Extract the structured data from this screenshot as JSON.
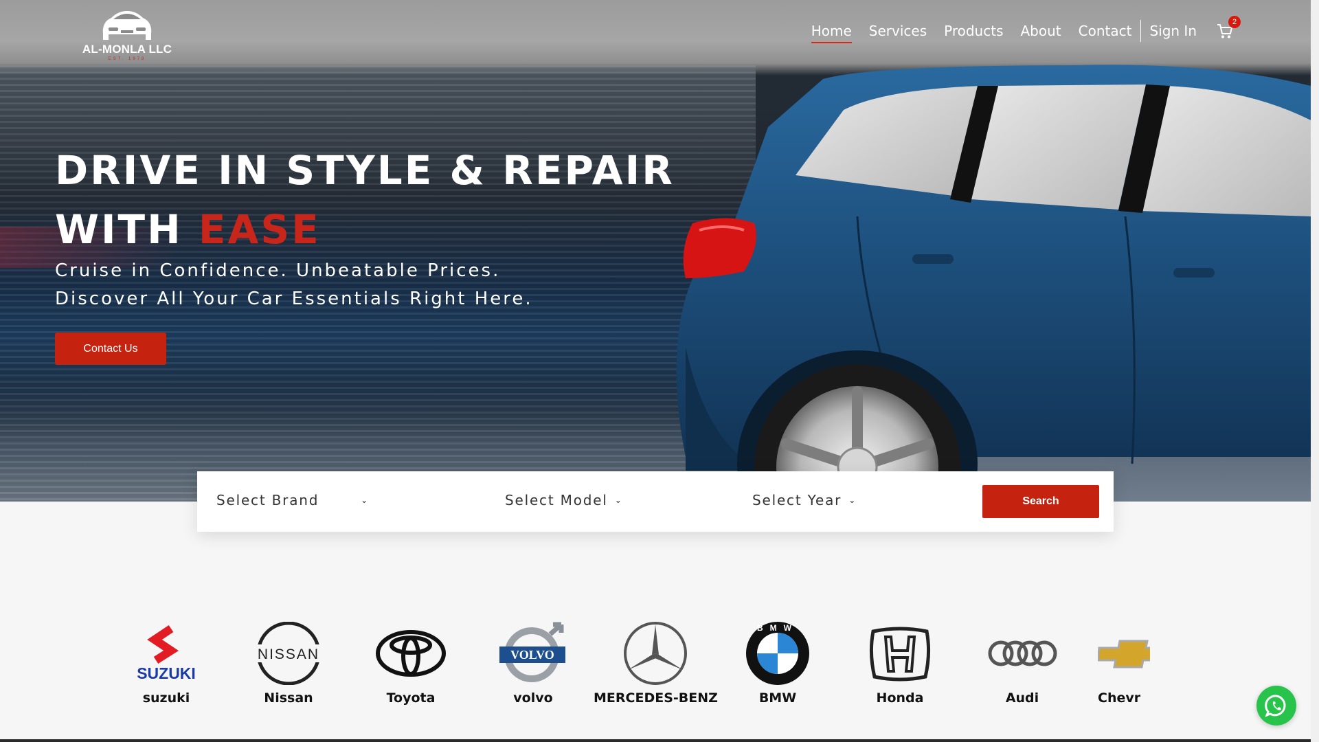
{
  "brand": {
    "name": "AL-MONLA LLC",
    "tagline": "EST. 1978"
  },
  "nav": {
    "items": [
      {
        "label": "Home",
        "active": true
      },
      {
        "label": "Services"
      },
      {
        "label": "Products"
      },
      {
        "label": "About"
      },
      {
        "label": "Contact"
      }
    ],
    "signin": "Sign In",
    "cart_count": "2",
    "cart_icon": "cart-icon"
  },
  "hero": {
    "headline_line1": "DRIVE IN STYLE & REPAIR",
    "headline_line2_prefix": "WITH ",
    "headline_line2_accent": "EASE",
    "sub_line1": "Cruise in Confidence. Unbeatable Prices.",
    "sub_line2": "Discover All Your Car Essentials Right Here.",
    "cta_label": "Contact Us"
  },
  "search": {
    "brand_placeholder": "Select Brand",
    "model_placeholder": "Select Model",
    "year_placeholder": "Select Year",
    "button_label": "Search"
  },
  "brands": [
    {
      "name": "suzuki"
    },
    {
      "name": "Nissan"
    },
    {
      "name": "Toyota"
    },
    {
      "name": "volvo"
    },
    {
      "name": "MERCEDES-BENZ"
    },
    {
      "name": "BMW"
    },
    {
      "name": "Honda"
    },
    {
      "name": "Audi"
    },
    {
      "name": "Chevr"
    }
  ],
  "logo_text": {
    "suzuki": "SUZUKI",
    "nissan": "NISSAN",
    "volvo": "VOLVO",
    "bmw": "BMW"
  },
  "colors": {
    "accent": "#c5230f",
    "whatsapp": "#28c34b",
    "car_blue": "#1d4f7c"
  }
}
